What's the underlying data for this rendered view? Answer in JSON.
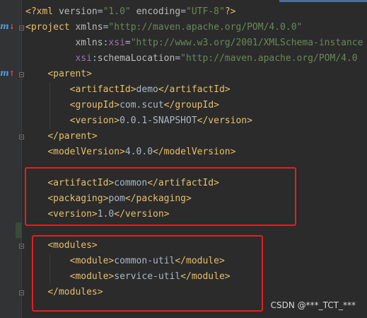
{
  "editor": {
    "lines": [
      {
        "parts": [
          [
            "tag",
            "<?xml "
          ],
          [
            "attr",
            "version"
          ],
          [
            "txt",
            "="
          ],
          [
            "val",
            "\"1.0\""
          ],
          [
            "txt",
            " "
          ],
          [
            "attr",
            "encoding"
          ],
          [
            "txt",
            "="
          ],
          [
            "val",
            "\"UTF-8\""
          ],
          [
            "tag",
            "?>"
          ]
        ]
      },
      {
        "parts": [
          [
            "tag",
            "<project "
          ],
          [
            "attr",
            "xmlns"
          ],
          [
            "txt",
            "="
          ],
          [
            "val",
            "\"http://maven.apache.org/POM/4.0.0\""
          ]
        ]
      },
      {
        "parts": [
          [
            "txt",
            "         "
          ],
          [
            "attr",
            "xmlns"
          ],
          [
            "txt",
            ":"
          ],
          [
            "ns",
            "xsi"
          ],
          [
            "txt",
            "="
          ],
          [
            "val",
            "\"http://www.w3.org/2001/XMLSchema-instance"
          ]
        ]
      },
      {
        "parts": [
          [
            "txt",
            "         "
          ],
          [
            "ns",
            "xsi"
          ],
          [
            "txt",
            ":"
          ],
          [
            "attr",
            "schemaLocation"
          ],
          [
            "txt",
            "="
          ],
          [
            "val",
            "\"http://maven.apache.org/POM/4.0"
          ]
        ]
      },
      {
        "parts": [
          [
            "txt",
            "    "
          ],
          [
            "tag",
            "<parent>"
          ]
        ]
      },
      {
        "parts": [
          [
            "txt",
            "        "
          ],
          [
            "tag",
            "<artifactId>"
          ],
          [
            "txt",
            "demo"
          ],
          [
            "tag",
            "</artifactId>"
          ]
        ]
      },
      {
        "parts": [
          [
            "txt",
            "        "
          ],
          [
            "tag",
            "<groupId>"
          ],
          [
            "txt",
            "com.scut"
          ],
          [
            "tag",
            "</groupId>"
          ]
        ]
      },
      {
        "parts": [
          [
            "txt",
            "        "
          ],
          [
            "tag",
            "<version>"
          ],
          [
            "txt",
            "0.0.1-SNAPSHOT"
          ],
          [
            "tag",
            "</version>"
          ]
        ]
      },
      {
        "parts": [
          [
            "txt",
            "    "
          ],
          [
            "tag",
            "</parent>"
          ]
        ]
      },
      {
        "parts": [
          [
            "txt",
            "    "
          ],
          [
            "tag",
            "<modelVersion>"
          ],
          [
            "txt",
            "4.0.0"
          ],
          [
            "tag",
            "</modelVersion>"
          ]
        ]
      },
      {
        "parts": []
      },
      {
        "parts": [
          [
            "txt",
            "    "
          ],
          [
            "tag",
            "<artifactId>"
          ],
          [
            "txt",
            "common"
          ],
          [
            "tag",
            "</artifactId>"
          ]
        ]
      },
      {
        "parts": [
          [
            "txt",
            "    "
          ],
          [
            "tag",
            "<packaging>"
          ],
          [
            "txt",
            "pom"
          ],
          [
            "tag",
            "</packaging>"
          ]
        ]
      },
      {
        "parts": [
          [
            "txt",
            "    "
          ],
          [
            "tag",
            "<version>"
          ],
          [
            "txt",
            "1.0"
          ],
          [
            "tag",
            "</version>"
          ]
        ]
      },
      {
        "parts": []
      },
      {
        "parts": [
          [
            "txt",
            "    "
          ],
          [
            "tag",
            "<modules>"
          ]
        ]
      },
      {
        "parts": [
          [
            "txt",
            "        "
          ],
          [
            "tag",
            "<module>"
          ],
          [
            "txt",
            "common-util"
          ],
          [
            "tag",
            "</module>"
          ]
        ]
      },
      {
        "parts": [
          [
            "txt",
            "        "
          ],
          [
            "tag",
            "<module>"
          ],
          [
            "txt",
            "service-util"
          ],
          [
            "tag",
            "</module>"
          ]
        ]
      },
      {
        "parts": [
          [
            "txt",
            "    "
          ],
          [
            "tag",
            "</modules>"
          ]
        ]
      }
    ]
  },
  "gutter_marks": [
    {
      "line": 1,
      "glyph": "m",
      "arrow": "↓"
    },
    {
      "line": 4,
      "glyph": "m",
      "arrow": "↑"
    }
  ],
  "watermark": "CSDN @***_TCT_***",
  "colors": {
    "background": "#2b2b2b",
    "tag": "#e8bf6a",
    "attribute": "#bababa",
    "namespace": "#9876aa",
    "string": "#6a8759",
    "text": "#a9b7c6",
    "highlight_box": "#e0201f"
  }
}
